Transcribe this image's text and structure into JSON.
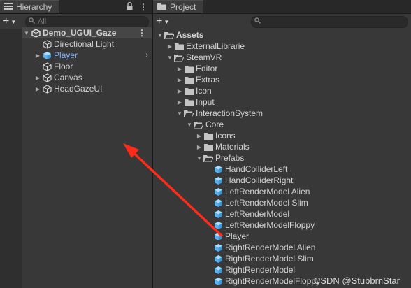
{
  "hierarchy": {
    "tab_label": "Hierarchy",
    "search_placeholder": "All",
    "scene": "Demo_UGUI_Gaze",
    "items": [
      {
        "label": "Directional Light",
        "icon": "cube-outline-icon",
        "arrow": false,
        "selected": false
      },
      {
        "label": "Player",
        "icon": "prefab-cube-icon",
        "arrow": true,
        "selected": true
      },
      {
        "label": "Floor",
        "icon": "cube-outline-icon",
        "arrow": false,
        "selected": false
      },
      {
        "label": "Canvas",
        "icon": "cube-outline-icon",
        "arrow": true,
        "selected": false
      },
      {
        "label": "HeadGazeUI",
        "icon": "cube-outline-icon",
        "arrow": true,
        "selected": false
      }
    ]
  },
  "project": {
    "tab_label": "Project",
    "tree": [
      {
        "label": "Assets",
        "depth": 0,
        "type": "folder",
        "expanded": true,
        "bold": true
      },
      {
        "label": "ExternalLibrarie",
        "depth": 1,
        "type": "folder",
        "expanded": false
      },
      {
        "label": "SteamVR",
        "depth": 1,
        "type": "folder",
        "expanded": true
      },
      {
        "label": "Editor",
        "depth": 2,
        "type": "folder",
        "expanded": false
      },
      {
        "label": "Extras",
        "depth": 2,
        "type": "folder",
        "expanded": false
      },
      {
        "label": "Icon",
        "depth": 2,
        "type": "folder",
        "expanded": false
      },
      {
        "label": "Input",
        "depth": 2,
        "type": "folder",
        "expanded": false
      },
      {
        "label": "InteractionSystem",
        "depth": 2,
        "type": "folder",
        "expanded": true
      },
      {
        "label": "Core",
        "depth": 3,
        "type": "folder",
        "expanded": true
      },
      {
        "label": "Icons",
        "depth": 4,
        "type": "folder",
        "expanded": false
      },
      {
        "label": "Materials",
        "depth": 4,
        "type": "folder",
        "expanded": false
      },
      {
        "label": "Prefabs",
        "depth": 4,
        "type": "folder",
        "expanded": true
      },
      {
        "label": "HandColliderLeft",
        "depth": 5,
        "type": "prefab"
      },
      {
        "label": "HandColliderRight",
        "depth": 5,
        "type": "prefab"
      },
      {
        "label": "LeftRenderModel Alien",
        "depth": 5,
        "type": "prefab"
      },
      {
        "label": "LeftRenderModel Slim",
        "depth": 5,
        "type": "prefab"
      },
      {
        "label": "LeftRenderModel",
        "depth": 5,
        "type": "prefab"
      },
      {
        "label": "LeftRenderModelFloppy",
        "depth": 5,
        "type": "prefab"
      },
      {
        "label": "Player",
        "depth": 5,
        "type": "prefab"
      },
      {
        "label": "RightRenderModel Alien",
        "depth": 5,
        "type": "prefab"
      },
      {
        "label": "RightRenderModel Slim",
        "depth": 5,
        "type": "prefab"
      },
      {
        "label": "RightRenderModel",
        "depth": 5,
        "type": "prefab"
      },
      {
        "label": "RightRenderModelFloppy",
        "depth": 5,
        "type": "prefab"
      }
    ]
  },
  "watermark": "CSDN @StubbrnStar",
  "colors": {
    "prefab": "#7fc3f2",
    "selected_text": "#7fb4ff",
    "arrow": "#ff2a1a",
    "folder": "#c4c4c4"
  }
}
